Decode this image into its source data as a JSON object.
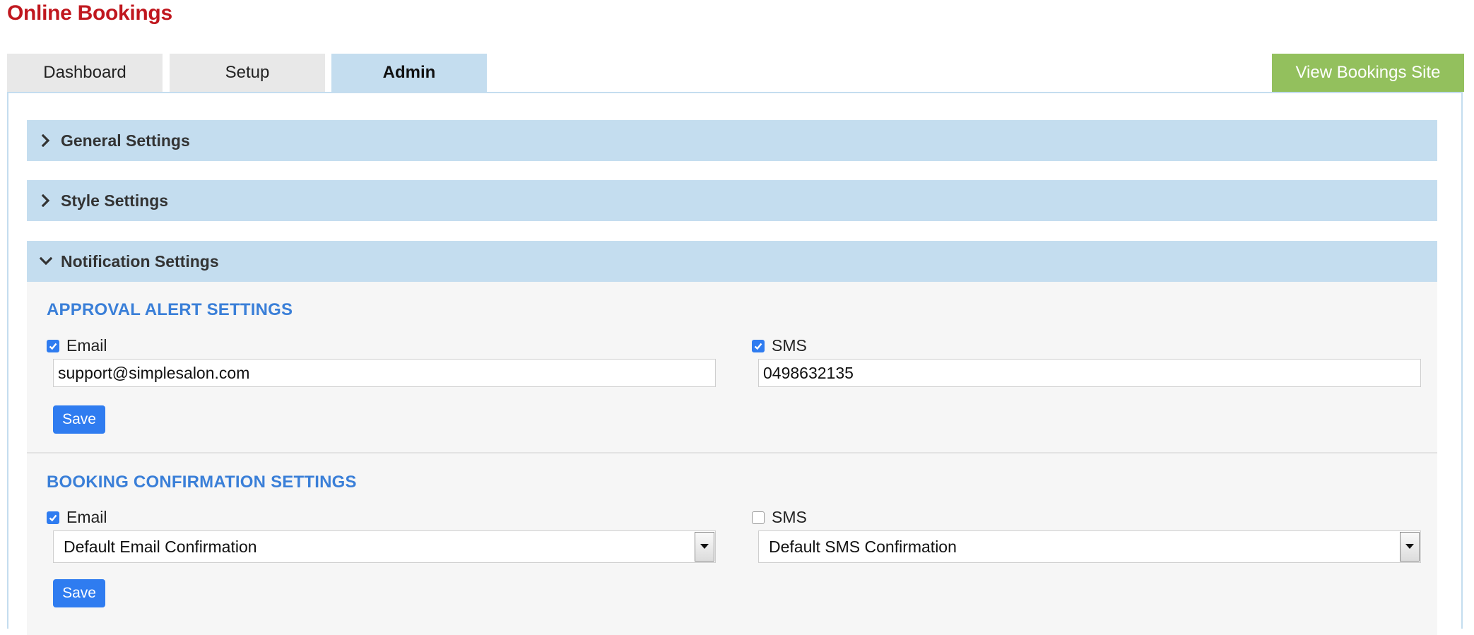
{
  "app": {
    "title": "Online Bookings"
  },
  "tabs": [
    {
      "label": "Dashboard",
      "active": false
    },
    {
      "label": "Setup",
      "active": false
    },
    {
      "label": "Admin",
      "active": true
    }
  ],
  "header": {
    "view_site_label": "View Bookings Site"
  },
  "accordion": [
    {
      "label": "General Settings",
      "expanded": false
    },
    {
      "label": "Style Settings",
      "expanded": false
    },
    {
      "label": "Notification Settings",
      "expanded": true
    }
  ],
  "approval": {
    "title": "APPROVAL ALERT SETTINGS",
    "email_label": "Email",
    "email_checked": true,
    "email_value": "support@simplesalon.com",
    "sms_label": "SMS",
    "sms_checked": true,
    "sms_value": "0498632135",
    "save_label": "Save"
  },
  "confirmation": {
    "title": "BOOKING CONFIRMATION SETTINGS",
    "email_label": "Email",
    "email_checked": true,
    "email_template": "Default Email Confirmation",
    "sms_label": "SMS",
    "sms_checked": false,
    "sms_template": "Default SMS Confirmation",
    "save_label": "Save"
  },
  "colors": {
    "brand_red": "#c0171e",
    "accent_blue": "#3a7fd8",
    "header_blue": "#c4ddef",
    "button_blue": "#2f7cf0",
    "site_green": "#93c05d"
  },
  "icons": {
    "collapsed": "chevron-right-icon",
    "expanded": "chevron-down-icon",
    "checkbox": "checkmark-icon",
    "select": "caret-down-icon"
  }
}
